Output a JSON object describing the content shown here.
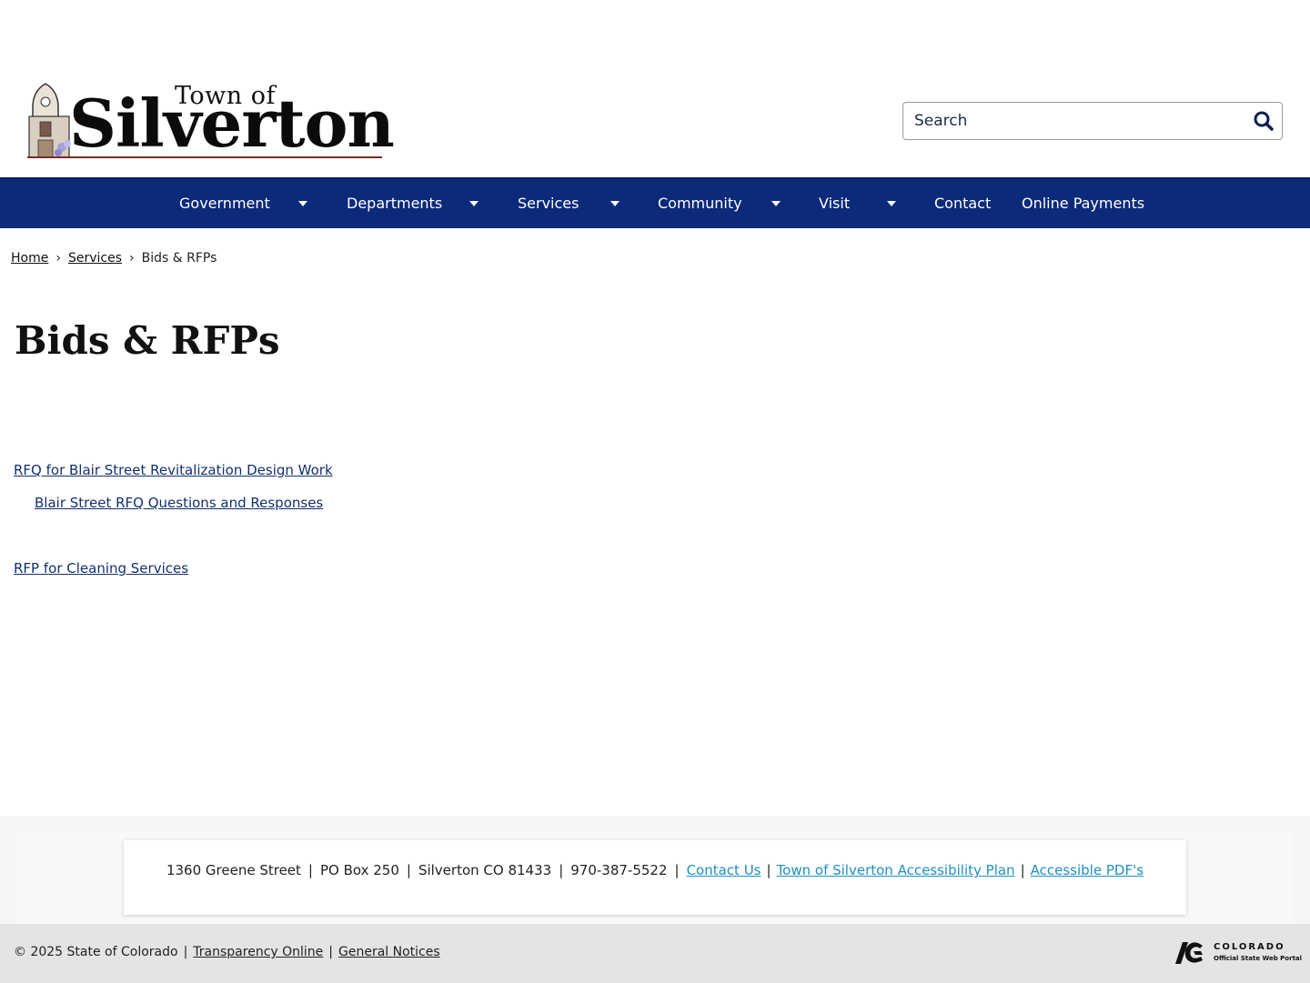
{
  "header": {
    "logo_top": "Town of",
    "logo_name": "Silverton",
    "search_placeholder": "Search"
  },
  "nav": {
    "items": [
      {
        "label": "Government",
        "dropdown": true
      },
      {
        "label": "Departments",
        "dropdown": true
      },
      {
        "label": "Services",
        "dropdown": true
      },
      {
        "label": "Community",
        "dropdown": true
      },
      {
        "label": "Visit",
        "dropdown": true
      },
      {
        "label": "Contact",
        "dropdown": false
      },
      {
        "label": "Online Payments",
        "dropdown": false
      }
    ]
  },
  "breadcrumb": {
    "home": "Home",
    "separator": "›",
    "services": "Services",
    "current": "Bids & RFPs"
  },
  "page": {
    "title": "Bids & RFPs",
    "links": [
      "RFQ for Blair Street Revitalization Design Work",
      "Blair Street RFQ Questions and Responses",
      "RFP for Cleaning Services"
    ]
  },
  "footer": {
    "address": "1360 Greene Street",
    "po_box": "PO Box 250",
    "city": "Silverton CO 81433",
    "phone": "970-387-5522",
    "sep": "|",
    "contact_link": "Contact Us",
    "accessibility_link": "Town of Silverton Accessibility Plan",
    "pdf_link": "Accessible PDF's"
  },
  "bottom": {
    "copyright": "© 2025 State of Colorado",
    "transparency": "Transparency Online",
    "notices": "General Notices",
    "portal_word": "COLORADO",
    "portal_sub": "Official State Web Portal"
  },
  "colors": {
    "nav_bg": "#0b2a7a",
    "link": "#12306e",
    "footer_link": "#1f8fc2"
  }
}
